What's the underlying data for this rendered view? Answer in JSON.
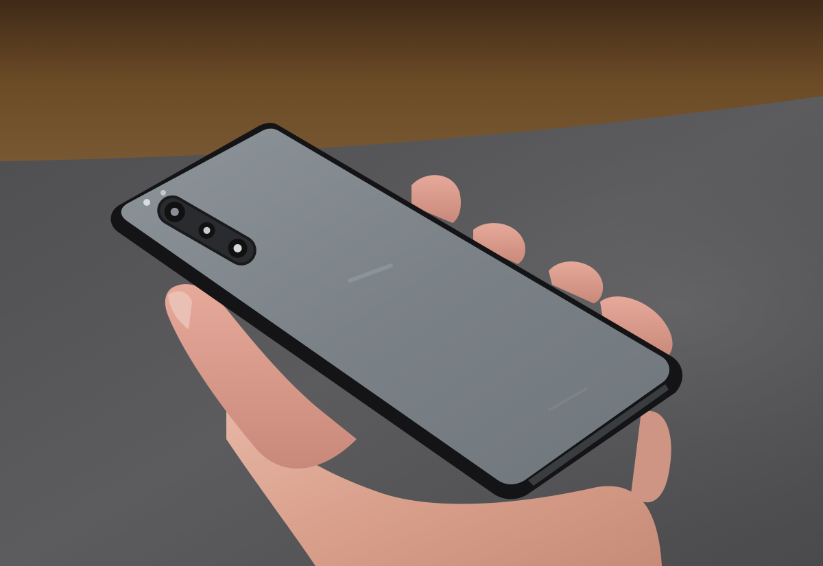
{
  "photo": {
    "subject": "smartphone-held-in-hand",
    "colors": {
      "floor_wood": "#6b4a26",
      "carpet": "#5a5a5c",
      "phone_back": "#7e858b",
      "phone_frame": "#141416",
      "skin": "#dba594",
      "camera_module": "#1a1a1c"
    },
    "back_logo": "",
    "back_small_text": ""
  }
}
